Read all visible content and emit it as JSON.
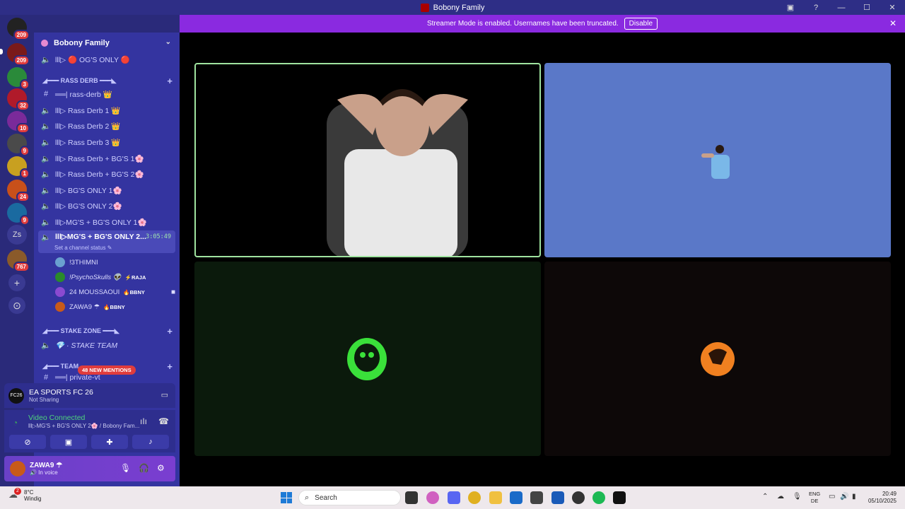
{
  "window": {
    "title": "Bobony Family"
  },
  "banner": {
    "text": "Streamer Mode is enabled. Usernames have been truncated.",
    "disable_label": "Disable"
  },
  "rail": {
    "servers": [
      {
        "badge": "209",
        "color": "#222"
      },
      {
        "badge": "209",
        "color": "#7a1a1a"
      },
      {
        "badge": "3",
        "color": "#2a8a3a"
      },
      {
        "badge": "32",
        "color": "#b01a2a"
      },
      {
        "badge": "10",
        "color": "#7a2a9a"
      },
      {
        "badge": "9",
        "color": "#4a4a4a"
      },
      {
        "badge": "1",
        "color": "#c8a020"
      },
      {
        "badge": "24",
        "color": "#c8501a"
      },
      {
        "badge": "9",
        "color": "#1a6aa0"
      },
      {
        "badge": "",
        "color": "#3a3a92"
      },
      {
        "badge": "767",
        "color": "#8a5a2a"
      }
    ],
    "zs_label": "Zs"
  },
  "sidebar": {
    "server_name": "Bobony Family",
    "items": {
      "ogs": "lll▷ 🔴 OG'S ONLY 🔴",
      "cat_rass": "◢━━━ RASS DERB ━━━◣",
      "rass_text": "══| rass-derb 👑",
      "rd1": "lll▷ Rass Derb 1 👑",
      "rd2": "lll▷ Rass Derb 2 👑",
      "rd3": "lll▷ Rass Derb 3 👑",
      "rdbg1": "lll▷ Rass Derb + BG'S 1🌸",
      "rdbg2": "lll▷ Rass Derb + BG'S 2🌸",
      "bg1": "lll▷ BG'S ONLY 1🌸",
      "bg2": "lll▷ BG'S ONLY 2🌸",
      "mgbg1": "lll▷MG'S + BG'S ONLY 1🌸",
      "mgbg2": "lll▷MG'S + BG'S ONLY 2...",
      "timer": "3:05:49",
      "status": "Set a channel status ✎",
      "cat_stake": "◢━━━ STAKE ZONE ━━━◣",
      "stake_team": "💎 · STAKE TEAM",
      "cat_team": "◢━━━ TEAM ",
      "private": "══| private-vt"
    },
    "members": [
      {
        "name": "!3THIMNI",
        "tag": "",
        "color": "#6aa0d0"
      },
      {
        "name": "!PsychoSkulls 👽",
        "tag": "⚡RAJA",
        "color": "#2a8a2a"
      },
      {
        "name": "24 MOUSSAOUI",
        "tag": "🔥BBNY",
        "color": "#8a4ad0"
      },
      {
        "name": "ZAWA9 ☂",
        "tag": "🔥BBNY",
        "color": "#c85a1a"
      }
    ],
    "mentions": "48 NEW MENTIONS"
  },
  "game": {
    "title": "EA SPORTS FC 26",
    "subtitle": "Not Sharing",
    "icon_text": "FC26"
  },
  "voice": {
    "title": "Video Connected",
    "subtitle": "lll▷MG'S + BG'S ONLY 2🌸 / Bobony Fam..."
  },
  "user": {
    "name": "ZAWA9 ☂",
    "status": "🔊 In voice"
  },
  "taskbar": {
    "weather_temp": "8°C",
    "weather_desc": "Windig",
    "weather_badge": "2",
    "search_placeholder": "Search",
    "lang_line1": "ENG",
    "lang_line2": "DE",
    "time": "20:49",
    "date": "05/10/2025"
  },
  "colors": {
    "accent": "#8a2ae0",
    "sidebar": "#3434a0",
    "speaking": "#9fe39f",
    "connected": "#4fd27d"
  }
}
